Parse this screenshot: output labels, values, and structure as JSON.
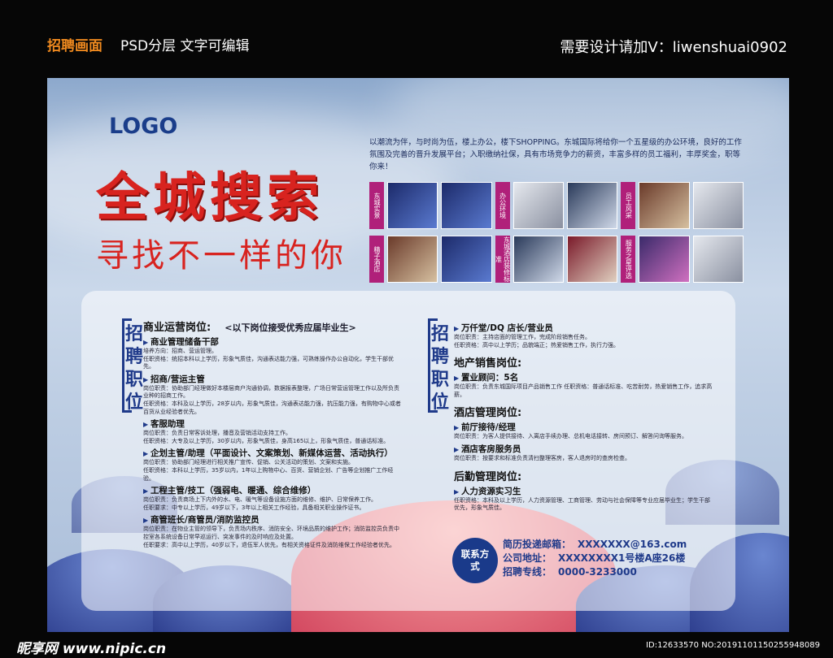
{
  "topbar": {
    "left_orange": "招聘画面",
    "left_white": "PSD分层  文字可编辑",
    "right": "需要设计请加V：liwenshuai0902"
  },
  "poster": {
    "logo": "LOGO",
    "headline": "全城搜索",
    "subline": "寻找不一样的你",
    "intro": "以潮流为伴，与时尚为伍，楼上办公，楼下SHOPPING。东城国际将给你一个五星级的办公环境，良好的工作氛围及完善的晋升发展平台；入职缴纳社保，具有市场竞争力的薪资，丰富多样的员工福利，丰厚奖金，职等你来！",
    "photo_tags": [
      "东城实景",
      "办公环境",
      "员工风采",
      "精子酒店",
      "东城酒店装修标准",
      "服务之星评选"
    ],
    "recruit_label": "招聘职位",
    "left": {
      "title": "商业运营岗位:",
      "note": "<以下岗位接受优秀应届毕业生>",
      "jobs": [
        {
          "name": "商业管理储备干部",
          "lines": [
            "培养方向：招商、营运管理。",
            "任职资格：统招本科以上学历，形象气质佳，沟通表达能力强，可熟练操作办公自动化，学生干部优先。"
          ]
        },
        {
          "name": "招商/营运主管",
          "lines": [
            "岗位职责：协助部门经理做好本楼层商户沟通协调，数据报表整理，广场日常营运管理工作以及所负责业种的招商工作。",
            "任职资格：本科及以上学历，28岁以内，形象气质佳，沟通表达能力强，抗压能力强，有购物中心或者百货从业经验者优先。"
          ]
        },
        {
          "name": "客服助理",
          "lines": [
            "岗位职责：负责日常客诉处理，播音及营销活动支持工作。",
            "任职资格：大专及以上学历，30岁以内，形象气质佳，身高165以上，形象气质佳，普通话标准。"
          ]
        },
        {
          "name": "企划主管/助理（平面设计、文案策划、新媒体运营、活动执行）",
          "lines": [
            "岗位职责：协助部门经理进行相关推广宣传、促销、公关活动的策划、文案和实施。",
            "任职资格：本科以上学历，35岁以内，1年以上购物中心、百货、营销企划、广告等企划推广工作经验。"
          ]
        },
        {
          "name": "工程主管/技工（强弱电、暖通、综合维修）",
          "lines": [
            "岗位职责：负责商场上下内外的水、电、暖气等设备设施方面的维修、维护、日常保养工作。",
            "任职要求：中专以上学历，49岁以下，3年以上相关工作经验，具备相关职业操作证书。"
          ]
        },
        {
          "name": "商管班长/商管员/消防监控员",
          "lines": [
            "岗位职责：在物业主管的领导下，负责场内秩序、消防安全、环境品质的维护工作；消防监控员负责中控室各系统设备日常早巡运行、突发事件的及时响应及处置。",
            "任职要求：高中以上学历，40岁以下，退伍军人优先，有相关资格证件及消防维保工作经验者优先。"
          ]
        }
      ]
    },
    "right": {
      "groups": [
        {
          "title": "",
          "jobs": [
            {
              "name": "万仟堂/DQ 店长/营业员",
              "lines": [
                "岗位职责：主持店面的管理工作，完成阶段销售任务。",
                "任职资格：高中以上学历；品貌端正；热爱销售工作，执行力强。"
              ]
            }
          ]
        },
        {
          "title": "地产销售岗位:",
          "jobs": [
            {
              "name": "置业顾问：5名",
              "lines": [
                "岗位职责：负责东城国际项目产品销售工作    任职资格：普通话标准、吃苦耐劳，热爱销售工作，追求高薪。"
              ]
            }
          ]
        },
        {
          "title": "酒店管理岗位:",
          "jobs": [
            {
              "name": "前厅接待/经理",
              "lines": [
                "岗位职责：为客人提供接待、入离店手续办理、总机电话接转、房间预订、解答问询等服务。"
              ]
            },
            {
              "name": "酒店客房服务员",
              "lines": [
                "岗位职责：按要求和标准负责清扫整理客房，客人退房时的查房检查。"
              ]
            }
          ]
        },
        {
          "title": "后勤管理岗位:",
          "jobs": [
            {
              "name": "人力资源实习生",
              "lines": [
                "任职资格：本科及以上学历，人力资源管理、工商管理、劳动与社会保障等专业应届毕业生；学生干部优先，形象气质佳。"
              ]
            }
          ]
        }
      ]
    },
    "contact": {
      "badge": "联系方式",
      "lines": [
        {
          "label": "简历投递邮箱：",
          "value": "XXXXXXX@163.com"
        },
        {
          "label": "公司地址：",
          "value": "XXXXXXXX1号楼A座26楼"
        },
        {
          "label": "招聘专线：",
          "value": "0000-3233000"
        }
      ]
    }
  },
  "footer": {
    "site": "昵享网 www.nipic.cn",
    "id": "ID:12633570 NO:20191101150255948089"
  },
  "colors": {
    "accent_blue": "#1f3a8a",
    "headline_red": "#d8231f",
    "tag_magenta": "#b0207a",
    "topbar_orange": "#f08a1f"
  }
}
